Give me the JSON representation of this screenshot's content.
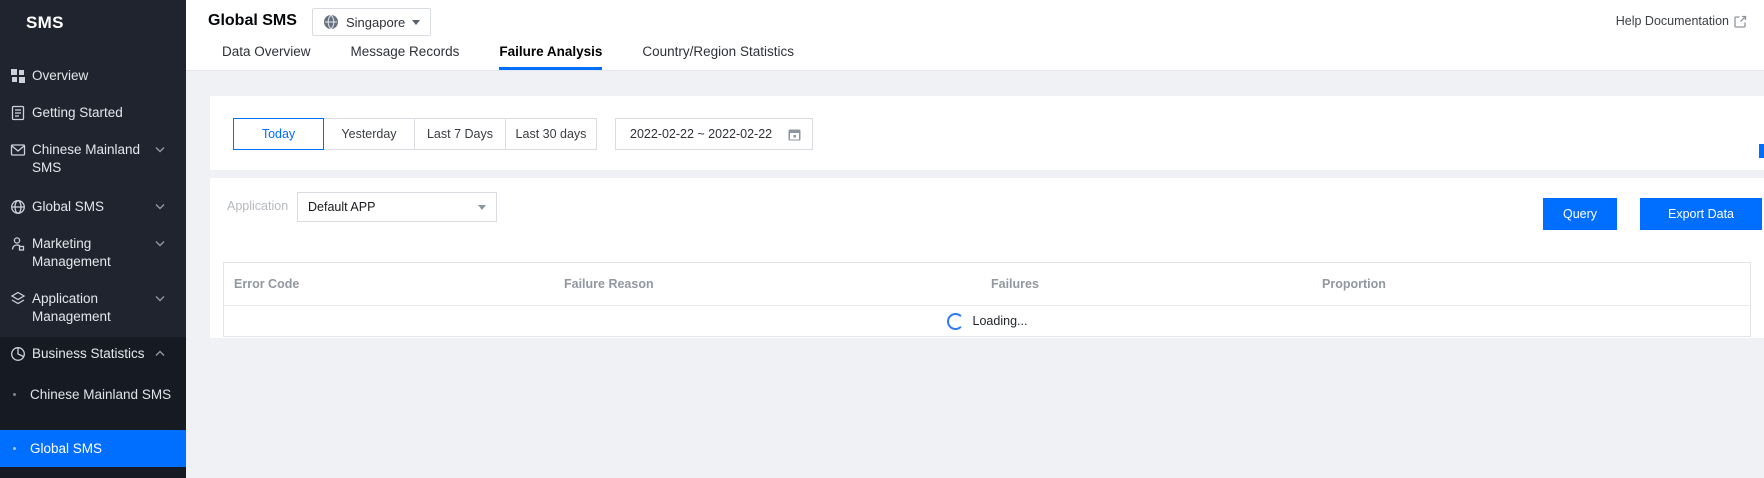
{
  "colors": {
    "accent": "#006eff",
    "sidebar_bg": "#20242e",
    "sidebar_group_bg": "#161a22",
    "content_bg": "#eff1f5"
  },
  "sidebar": {
    "title": "SMS",
    "items": [
      "Overview",
      "Getting Started",
      "Chinese Mainland SMS",
      "Global SMS",
      "Marketing Management",
      "Application Management",
      "Business Statistics"
    ],
    "item_icons": [
      "grid-icon",
      "document-icon",
      "envelope-icon",
      "globe-icon",
      "person-icon",
      "layers-icon",
      "pie-chart-icon"
    ],
    "subitems": [
      "Chinese Mainland SMS",
      "Global SMS"
    ],
    "active_item": "Global SMS"
  },
  "topbar": {
    "title": "Global SMS",
    "region": "Singapore",
    "help_link": "Help Documentation",
    "tabs": [
      "Data Overview",
      "Message Records",
      "Failure Analysis",
      "Country/Region Statistics"
    ],
    "active_tab": "Failure Analysis"
  },
  "filters": {
    "presets": [
      "Today",
      "Yesterday",
      "Last 7 Days",
      "Last 30 days"
    ],
    "active_preset": "Today",
    "date_range": "2022-02-22 ~ 2022-02-22"
  },
  "query_bar": {
    "application_label": "Application",
    "application_value": "Default APP",
    "query_button": "Query",
    "export_button": "Export Data"
  },
  "table": {
    "columns": [
      "Error Code",
      "Failure Reason",
      "Failures",
      "Proportion"
    ],
    "loading_text": "Loading..."
  },
  "icons": [
    "grid-icon",
    "document-icon",
    "envelope-icon",
    "globe-icon",
    "person-icon",
    "layers-icon",
    "pie-chart-icon",
    "chevron-down-icon",
    "chevron-up-icon",
    "calendar-icon",
    "external-link-icon",
    "caret-down-icon",
    "spinner-icon",
    "bullet-dot-icon"
  ]
}
